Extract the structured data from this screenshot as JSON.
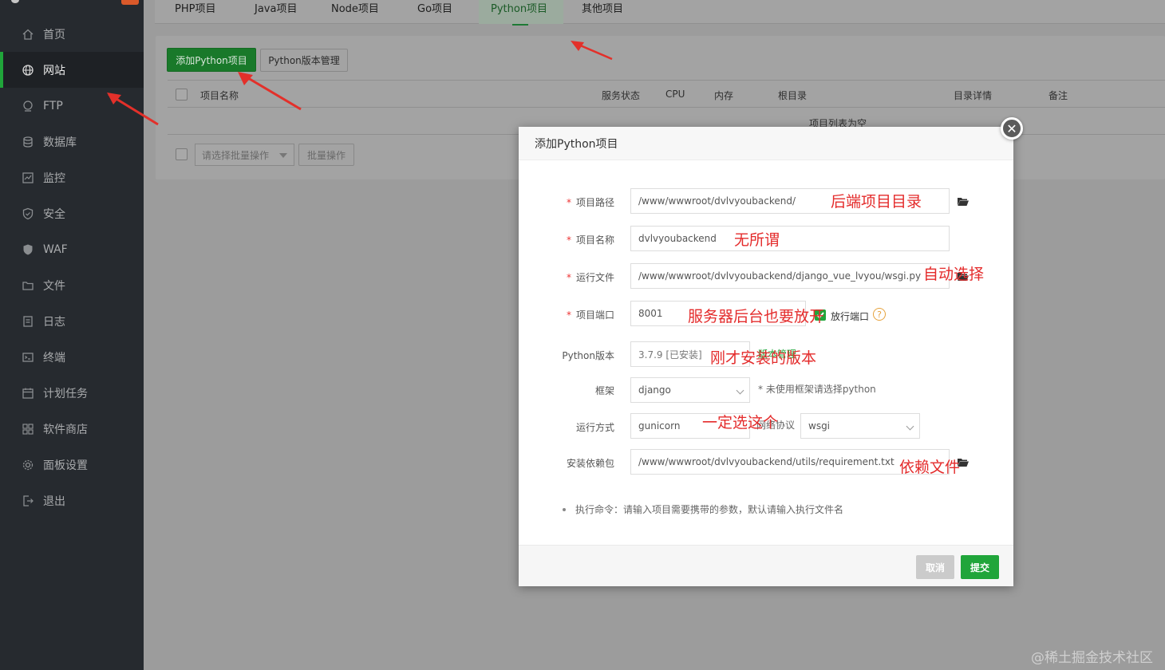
{
  "sidebar": {
    "items": [
      {
        "label": "首页",
        "icon": "home-icon"
      },
      {
        "label": "网站",
        "icon": "globe-icon",
        "active": true
      },
      {
        "label": "FTP",
        "icon": "ftp-icon"
      },
      {
        "label": "数据库",
        "icon": "database-icon"
      },
      {
        "label": "监控",
        "icon": "monitor-icon"
      },
      {
        "label": "安全",
        "icon": "shield-icon"
      },
      {
        "label": "WAF",
        "icon": "waf-shield-icon"
      },
      {
        "label": "文件",
        "icon": "folder-icon"
      },
      {
        "label": "日志",
        "icon": "log-icon"
      },
      {
        "label": "终端",
        "icon": "terminal-icon"
      },
      {
        "label": "计划任务",
        "icon": "schedule-icon"
      },
      {
        "label": "软件商店",
        "icon": "apps-icon"
      },
      {
        "label": "面板设置",
        "icon": "gear-icon"
      },
      {
        "label": "退出",
        "icon": "logout-icon"
      }
    ]
  },
  "tabs": [
    "PHP项目",
    "Java项目",
    "Node项目",
    "Go项目",
    "Python项目",
    "其他项目"
  ],
  "toolbar": {
    "add_label": "添加Python项目",
    "version_label": "Python版本管理"
  },
  "table": {
    "columns": [
      "项目名称",
      "服务状态",
      "CPU",
      "内存",
      "根目录",
      "目录详情",
      "备注"
    ],
    "empty_text": "项目列表为空"
  },
  "batch": {
    "select_placeholder": "请选择批量操作",
    "button_label": "批量操作"
  },
  "modal": {
    "title": "添加Python项目",
    "fields": {
      "path": {
        "label": "项目路径",
        "value": "/www/wwwroot/dvlvyoubackend/"
      },
      "name": {
        "label": "项目名称",
        "value": "dvlvyoubackend"
      },
      "run_file": {
        "label": "运行文件",
        "value": "/www/wwwroot/dvlvyoubackend/django_vue_lvyou/wsgi.py"
      },
      "port": {
        "label": "项目端口",
        "value": "8001",
        "open_port_label": "放行端口"
      },
      "version": {
        "label": "Python版本",
        "value": "3.7.9 [已安装]",
        "link": "版本管理"
      },
      "framework": {
        "label": "框架",
        "value": "django",
        "hint": "* 未使用框架请选择python"
      },
      "run_mode": {
        "label": "运行方式",
        "value": "gunicorn",
        "protocol_label": "网络协议",
        "protocol_value": "wsgi"
      },
      "deps": {
        "label": "安装依赖包",
        "value": "/www/wwwroot/dvlvyoubackend/utils/requirement.txt"
      }
    },
    "note": "执行命令：请输入项目需要携带的参数，默认请输入执行文件名",
    "cancel_label": "取消",
    "submit_label": "提交"
  },
  "annotations": {
    "path": "后端项目目录",
    "name": "无所谓",
    "run_file": "自动选择",
    "port": "服务器后台也要放开",
    "version": "刚才安装的版本",
    "run_mode": "一定选这个",
    "deps": "依赖文件"
  },
  "watermark": "@稀土掘金技术社区",
  "colors": {
    "accent": "#20a53a",
    "annotation": "#e42b2b",
    "sidebar_bg": "#262a2f"
  }
}
